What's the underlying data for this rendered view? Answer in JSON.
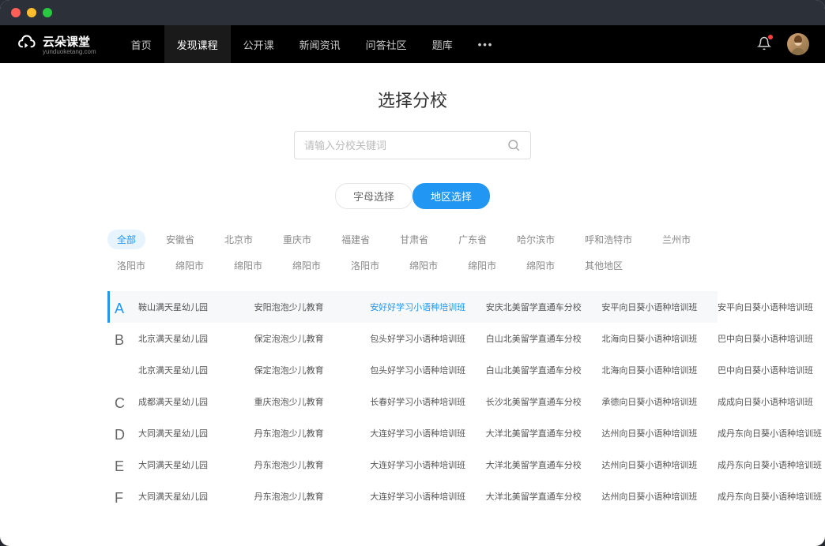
{
  "logo": {
    "name": "云朵课堂",
    "sub": "yunduoketang.com"
  },
  "nav": {
    "items": [
      "首页",
      "发现课程",
      "公开课",
      "新闻资讯",
      "问答社区",
      "题库"
    ],
    "activeIndex": 1,
    "more": "•••"
  },
  "page": {
    "title": "选择分校",
    "searchPlaceholder": "请输入分校关键词"
  },
  "tabs": {
    "letter": "字母选择",
    "region": "地区选择"
  },
  "regions": {
    "active": "全部",
    "row1": [
      "全部",
      "安徽省",
      "北京市",
      "重庆市",
      "福建省",
      "甘肃省",
      "广东省",
      "哈尔滨市",
      "呼和浩特市",
      "兰州市",
      "洛阳市",
      "绵阳市",
      "绵阳市",
      "绵阳市"
    ],
    "row2": [
      "洛阳市",
      "绵阳市",
      "绵阳市",
      "绵阳市",
      "其他地区"
    ]
  },
  "sections": [
    {
      "letter": "A",
      "selected": true,
      "rows": [
        {
          "schools": [
            "鞍山满天星幼儿园",
            "安阳泡泡少儿教育",
            "安好好学习小语种培训班",
            "安庆北美留学直通车分校",
            "安平向日葵小语种培训班",
            "安平向日葵小语种培训班"
          ],
          "highlight": 2
        }
      ]
    },
    {
      "letter": "B",
      "selected": false,
      "rows": [
        {
          "schools": [
            "北京满天星幼儿园",
            "保定泡泡少儿教育",
            "包头好学习小语种培训班",
            "白山北美留学直通车分校",
            "北海向日葵小语种培训班",
            "巴中向日葵小语种培训班"
          ]
        },
        {
          "schools": [
            "北京满天星幼儿园",
            "保定泡泡少儿教育",
            "包头好学习小语种培训班",
            "白山北美留学直通车分校",
            "北海向日葵小语种培训班",
            "巴中向日葵小语种培训班"
          ]
        }
      ]
    },
    {
      "letter": "C",
      "selected": false,
      "rows": [
        {
          "schools": [
            "成都满天星幼儿园",
            "重庆泡泡少儿教育",
            "长春好学习小语种培训班",
            "长沙北美留学直通车分校",
            "承德向日葵小语种培训班",
            "成成向日葵小语种培训班"
          ]
        }
      ]
    },
    {
      "letter": "D",
      "selected": false,
      "rows": [
        {
          "schools": [
            "大同满天星幼儿园",
            "丹东泡泡少儿教育",
            "大连好学习小语种培训班",
            "大洋北美留学直通车分校",
            "达州向日葵小语种培训班",
            "成丹东向日葵小语种培训班"
          ]
        }
      ]
    },
    {
      "letter": "E",
      "selected": false,
      "rows": [
        {
          "schools": [
            "大同满天星幼儿园",
            "丹东泡泡少儿教育",
            "大连好学习小语种培训班",
            "大洋北美留学直通车分校",
            "达州向日葵小语种培训班",
            "成丹东向日葵小语种培训班"
          ]
        }
      ]
    },
    {
      "letter": "F",
      "selected": false,
      "rows": [
        {
          "schools": [
            "大同满天星幼儿园",
            "丹东泡泡少儿教育",
            "大连好学习小语种培训班",
            "大洋北美留学直通车分校",
            "达州向日葵小语种培训班",
            "成丹东向日葵小语种培训班"
          ]
        }
      ]
    }
  ]
}
